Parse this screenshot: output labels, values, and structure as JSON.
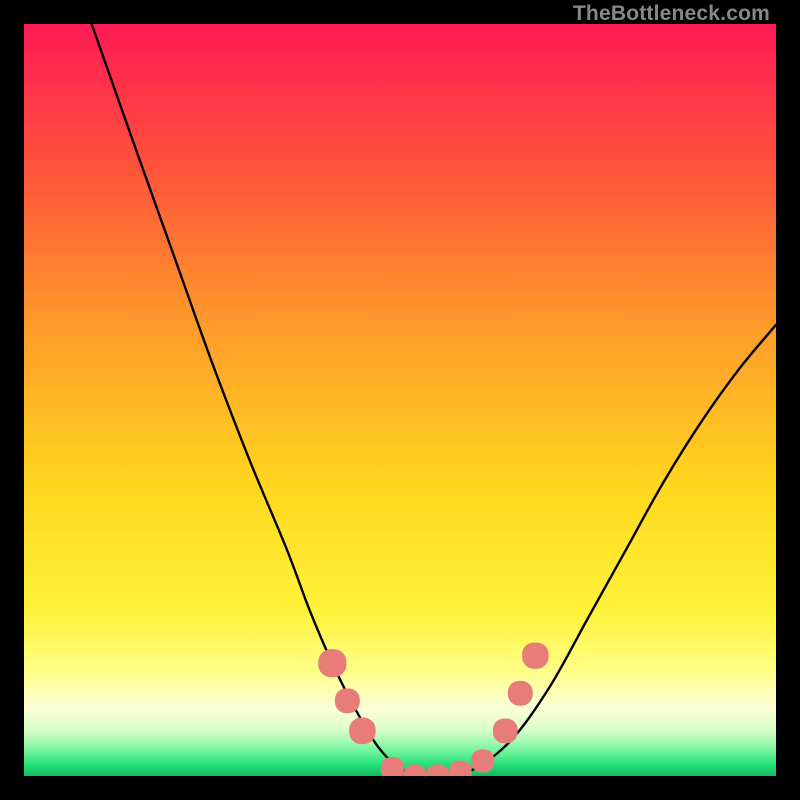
{
  "watermark": "TheBottleneck.com",
  "colors": {
    "top": "#ff1a4d",
    "mid_upper": "#ff8a2a",
    "mid": "#ffe600",
    "low_yellow": "#ffff7a",
    "pale": "#fbffd6",
    "green": "#25f07a",
    "black": "#000000",
    "curve": "#000000",
    "marker": "#e87c78"
  },
  "chart_data": {
    "type": "line",
    "title": "",
    "xlabel": "",
    "ylabel": "",
    "xlim": [
      0,
      100
    ],
    "ylim": [
      0,
      100
    ],
    "series": [
      {
        "name": "bottleneck-curve",
        "x": [
          9,
          15,
          20,
          25,
          30,
          35,
          38,
          41,
          44,
          47,
          50,
          53,
          56,
          60,
          65,
          70,
          75,
          80,
          85,
          90,
          95,
          100
        ],
        "y": [
          100,
          83,
          69,
          55,
          42,
          30,
          22,
          15,
          9,
          4,
          1,
          0,
          0,
          1,
          5,
          12,
          21,
          30,
          39,
          47,
          54,
          60
        ]
      }
    ],
    "markers": [
      {
        "x": 41,
        "y": 15,
        "r": 1.7
      },
      {
        "x": 43,
        "y": 10,
        "r": 1.5
      },
      {
        "x": 45,
        "y": 6,
        "r": 1.6
      },
      {
        "x": 49,
        "y": 1,
        "r": 1.4
      },
      {
        "x": 52,
        "y": 0,
        "r": 1.4
      },
      {
        "x": 55,
        "y": 0,
        "r": 1.4
      },
      {
        "x": 58,
        "y": 0.5,
        "r": 1.4
      },
      {
        "x": 61,
        "y": 2,
        "r": 1.4
      },
      {
        "x": 64,
        "y": 6,
        "r": 1.5
      },
      {
        "x": 66,
        "y": 11,
        "r": 1.5
      },
      {
        "x": 68,
        "y": 16,
        "r": 1.6
      }
    ],
    "annotations": []
  }
}
